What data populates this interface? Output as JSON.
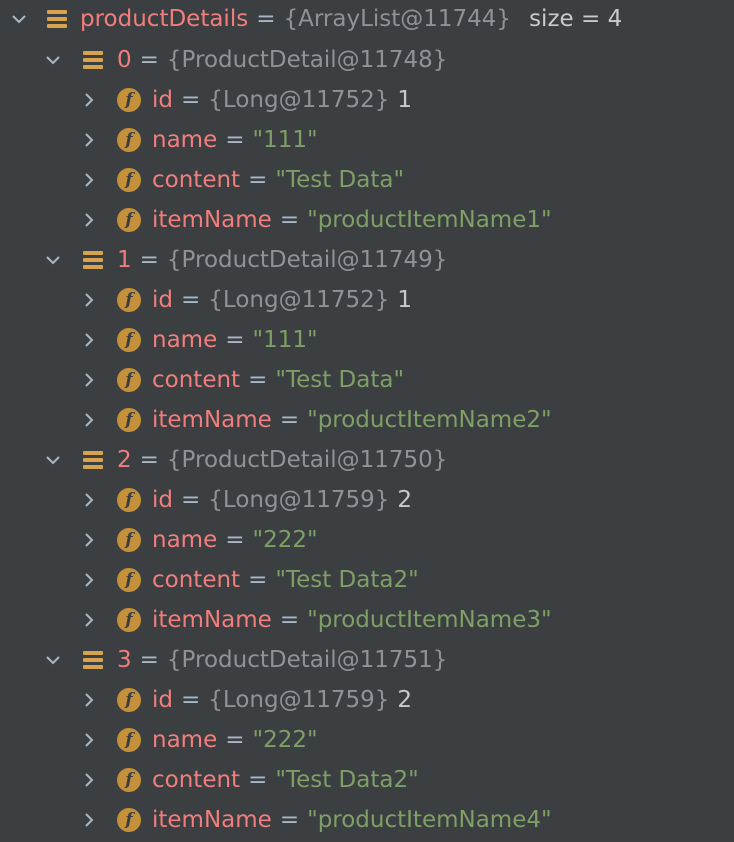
{
  "root": {
    "name": "productDetails",
    "type": "{ArrayList@11744}",
    "size": "size = 4"
  },
  "items": [
    {
      "index": "0",
      "type": "{ProductDetail@11748}",
      "id_type": "{Long@11752}",
      "id_value": "1",
      "name_value": "\"111\"",
      "content_value": "\"Test Data\"",
      "itemName_value": "\"productItemName1\""
    },
    {
      "index": "1",
      "type": "{ProductDetail@11749}",
      "id_type": "{Long@11752}",
      "id_value": "1",
      "name_value": "\"111\"",
      "content_value": "\"Test Data\"",
      "itemName_value": "\"productItemName2\""
    },
    {
      "index": "2",
      "type": "{ProductDetail@11750}",
      "id_type": "{Long@11759}",
      "id_value": "2",
      "name_value": "\"222\"",
      "content_value": "\"Test Data2\"",
      "itemName_value": "\"productItemName3\""
    },
    {
      "index": "3",
      "type": "{ProductDetail@11751}",
      "id_type": "{Long@11759}",
      "id_value": "2",
      "name_value": "\"222\"",
      "content_value": "\"Test Data2\"",
      "itemName_value": "\"productItemName4\""
    }
  ],
  "field_labels": {
    "id": "id",
    "name": "name",
    "content": "content",
    "itemName": "itemName",
    "equals": "=",
    "field_icon_letter": "f"
  },
  "icons": {
    "expanded": "chevron-down-icon",
    "collapsed": "chevron-right-icon",
    "list": "list-icon",
    "field": "field-icon"
  },
  "colors": {
    "background": "#3c3f41",
    "variable_name": "#f27d7d",
    "type_info": "#8f9398",
    "string_value": "#7e9f65",
    "plain_value": "#c8cacd",
    "icon_accent": "#d8a34e"
  }
}
